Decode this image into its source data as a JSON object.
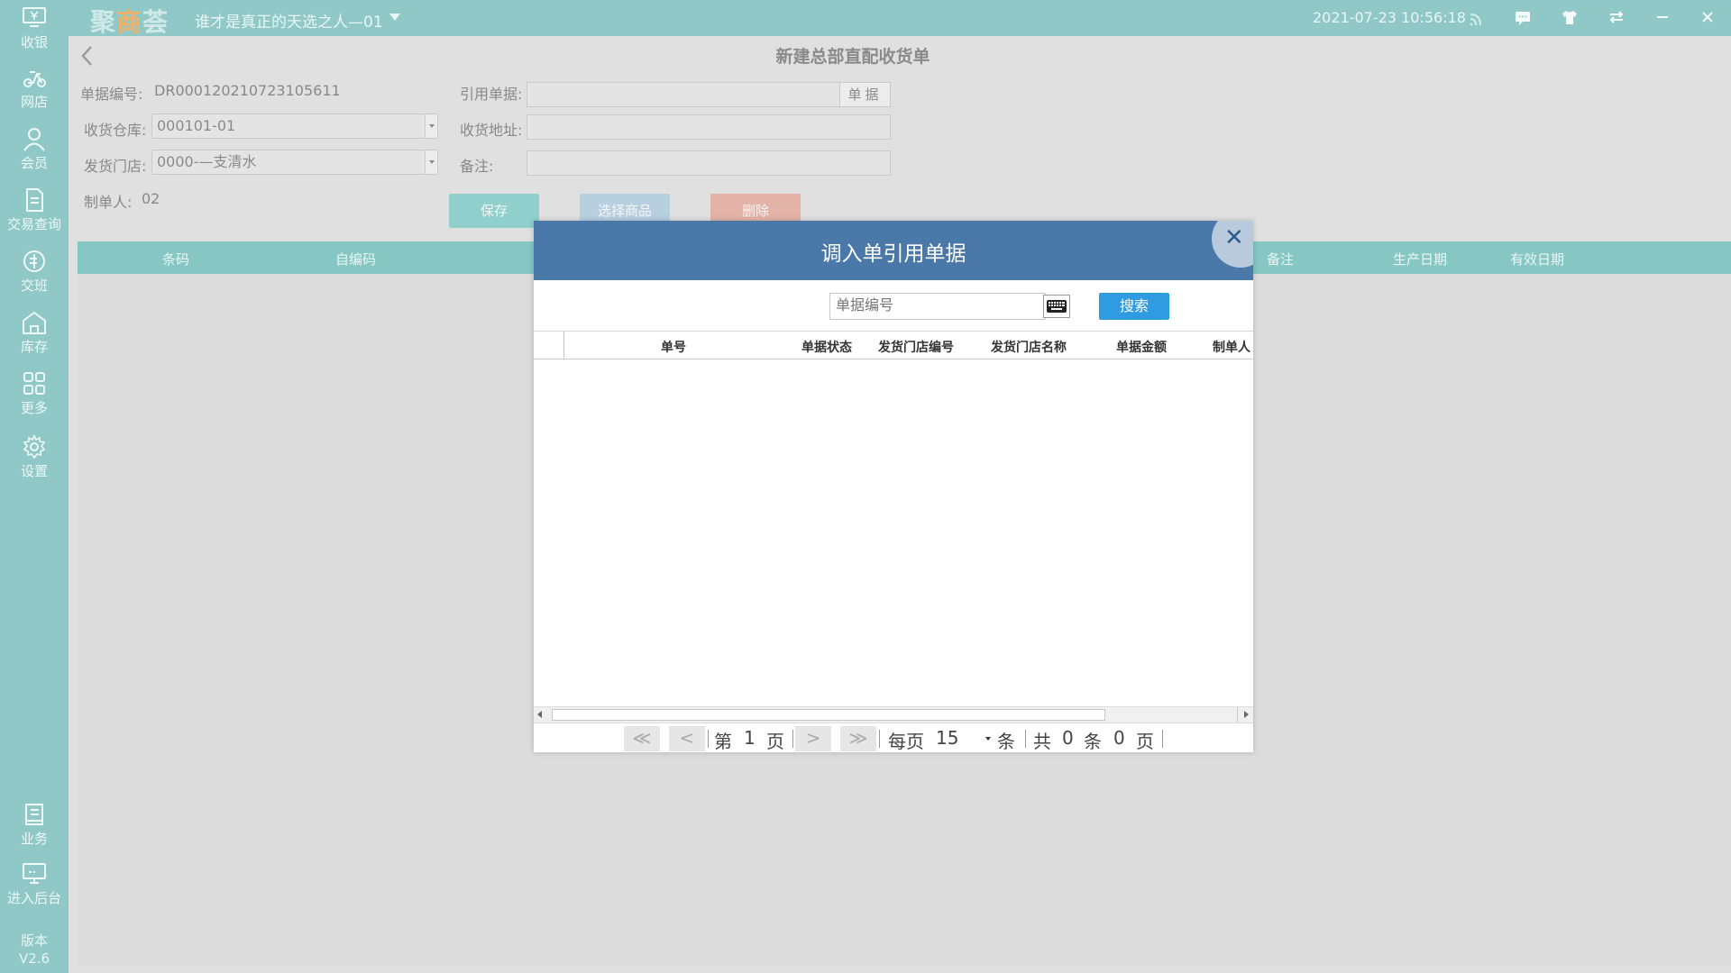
{
  "app": {
    "logo": "聚商荟",
    "store_name": "谁才是真正的天选之人—01",
    "datetime": "2021-07-23 10:56:18"
  },
  "sidebar": {
    "items": [
      {
        "label": "收银",
        "icon": "cashier-icon"
      },
      {
        "label": "网店",
        "icon": "scooter-icon"
      },
      {
        "label": "会员",
        "icon": "member-icon"
      },
      {
        "label": "交易查询",
        "icon": "document-icon"
      },
      {
        "label": "交班",
        "icon": "shift-icon"
      },
      {
        "label": "库存",
        "icon": "warehouse-icon"
      },
      {
        "label": "更多",
        "icon": "grid-icon"
      },
      {
        "label": "设置",
        "icon": "gear-icon"
      },
      {
        "label": "业务",
        "icon": "book-icon"
      },
      {
        "label": "进入后台",
        "icon": "monitor-icon"
      }
    ],
    "version_label": "版本",
    "version": "V2.6"
  },
  "page": {
    "title": "新建总部直配收货单",
    "doc_no_label": "单据编号:",
    "doc_no": "DR000120210723105611",
    "warehouse_label": "收货仓库:",
    "warehouse": "000101-01",
    "store_label": "发货门店:",
    "store": "0000-—支清水",
    "maker_label": "制单人:",
    "maker": "02",
    "ref_doc_label": "引用单据:",
    "ref_doc_button": "单据",
    "address_label": "收货地址:",
    "remark_label": "备注:",
    "buttons": {
      "save": "保存",
      "select_goods": "选择商品",
      "delete": "删除"
    },
    "grid_columns": [
      "条码",
      "自编码",
      "备注",
      "生产日期",
      "有效日期"
    ]
  },
  "modal": {
    "title": "调入单引用单据",
    "search_placeholder": "单据编号",
    "search_button": "搜索",
    "columns": [
      "单号",
      "单据状态",
      "发货门店编号",
      "发货门店名称",
      "单据金额",
      "制单人"
    ],
    "rows": [],
    "pager": {
      "first": "≪",
      "prev": "<",
      "next": ">",
      "last": "≫",
      "page_prefix": "第",
      "page": "1",
      "page_suffix": "页",
      "per_page_prefix": "每页",
      "per_page": "15",
      "per_page_suffix": "条",
      "total_prefix": "共",
      "total_count": "0",
      "total_count_suffix": "条",
      "total_pages": "0",
      "total_pages_suffix": "页"
    }
  },
  "colors": {
    "sidebar": "#8fc8c6",
    "modal_header": "#4a78a8",
    "search_button": "#2f9be0",
    "save_button": "#8fd0cc",
    "select_goods_button": "#b8cfe0",
    "delete_button": "#e3b3a8"
  }
}
